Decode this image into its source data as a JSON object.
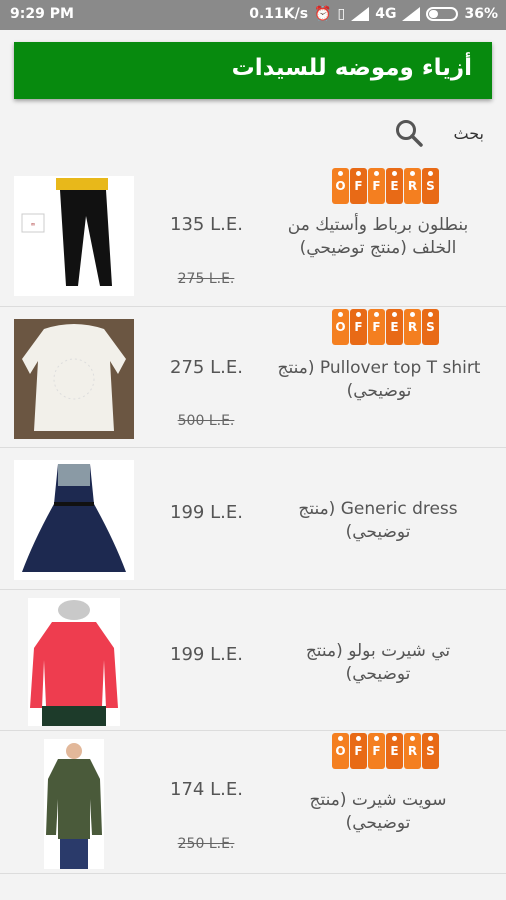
{
  "status": {
    "time": "9:29 PM",
    "speed": "0.11K/s",
    "network": "4G",
    "battery": "36%",
    "battery_level": 0.36
  },
  "appbar": {
    "title": "أزياء وموضه للسيدات"
  },
  "search": {
    "label": "بحث"
  },
  "offer_badge": {
    "letters": [
      "O",
      "F",
      "F",
      "E",
      "R",
      "S"
    ]
  },
  "products": [
    {
      "name": "بنطلون برباط وأستيك من الخلف (منتج توضيحي)",
      "price": "135 L.E.",
      "old_price": "275 L.E.",
      "offer": true
    },
    {
      "name": "Pullover top T shirt (منتج توضيحي)",
      "price": "275 L.E.",
      "old_price": "500 L.E.",
      "offer": true
    },
    {
      "name": "Generic dress (منتج توضيحي)",
      "price": "199 L.E.",
      "old_price": "",
      "offer": false
    },
    {
      "name": "تي شيرت بولو (منتج توضيحي)",
      "price": "199 L.E.",
      "old_price": "",
      "offer": false
    },
    {
      "name": "سويت شيرت (منتج توضيحي)",
      "price": "174 L.E.",
      "old_price": "250 L.E.",
      "offer": true
    }
  ],
  "colors": {
    "appbar": "#078a0e",
    "offer": "#f47f20"
  }
}
